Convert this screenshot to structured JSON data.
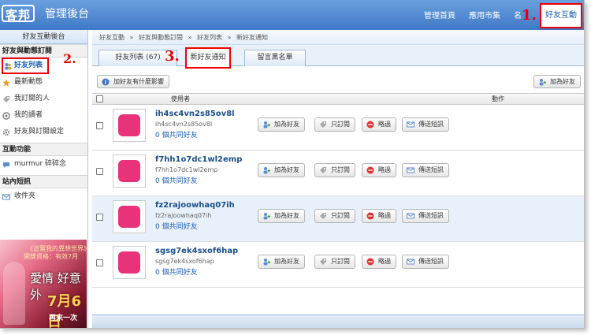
{
  "header": {
    "logo": "客邦",
    "title": "管理後台",
    "nav": [
      "管理首頁",
      "應用市集",
      "名"
    ],
    "nav_active": "好友互動"
  },
  "callouts": [
    "1.",
    "2.",
    "3."
  ],
  "sidebar": {
    "head": "好友互動後台",
    "section1": "好友與動態訂閱",
    "items1": [
      "好友列表",
      "最新動態",
      "我訂閱的人",
      "我的讀者",
      "好友與訂閱設定"
    ],
    "section2": "互動功能",
    "items2": [
      "murmur 碎碎念"
    ],
    "section3": "站內短訊",
    "items3": [
      "收件夾"
    ],
    "ad": {
      "line1": "《這實我的異想世界》",
      "line2": "開獎資格：有效7月",
      "line3": "愛情 好意外",
      "line4": "7月6日",
      "line5": "再來一次"
    }
  },
  "breadcrumb": [
    "好友互動",
    "»",
    "好友與動態訂閱",
    "»",
    "好友列表",
    "»",
    "新好友通知"
  ],
  "tabs": [
    "好友列表 (67)",
    "新好友通知",
    "留言黑名單"
  ],
  "toolbar": {
    "info_button": "加好友有什麼影響",
    "add_button": "加為好友"
  },
  "table": {
    "col_user": "使用者",
    "col_action": "動作",
    "rows": [
      {
        "name": "ih4sc4vn2s85ov8l",
        "id": "ih4sc4vn2s85ov8l",
        "mutual": "0 個共同好友"
      },
      {
        "name": "f7hh1o7dc1wl2emp",
        "id": "f7hh1o7dc1wl2emp",
        "mutual": "0 個共同好友"
      },
      {
        "name": "fz2rajoowhaq07ih",
        "id": "fz2rajoowhaq07ih",
        "mutual": "0 個共同好友"
      },
      {
        "name": "sgsg7ek4sxof6hap",
        "id": "sgsg7ek4sxof6hap",
        "mutual": "0 個共同好友"
      }
    ],
    "actions": [
      "加為好友",
      "只訂閱",
      "略過",
      "傳送短訊"
    ]
  }
}
